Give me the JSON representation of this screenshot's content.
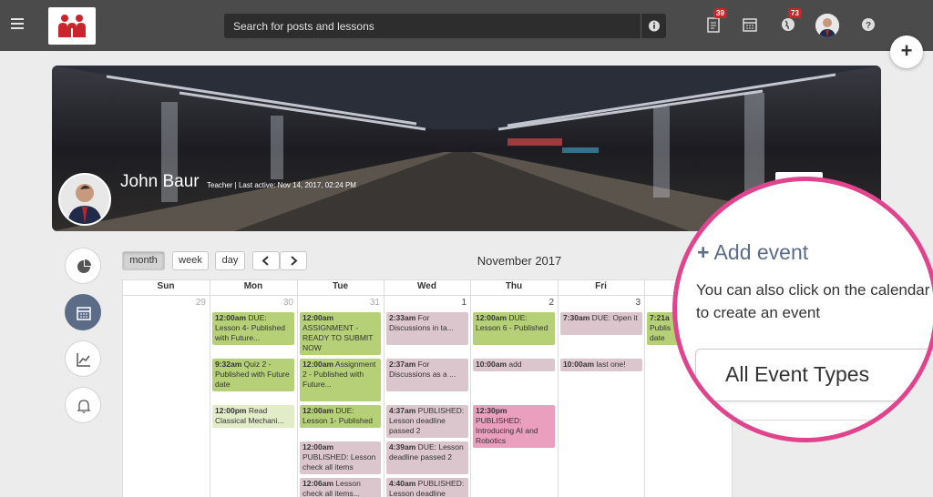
{
  "topbar": {
    "search_placeholder": "Search for posts and lessons",
    "icons": [
      "hamburger-icon",
      "notifications-icon",
      "calendar-icon",
      "globe-icon",
      "help-icon",
      "info-icon"
    ],
    "notifications_count": "39",
    "globe_count": "73",
    "accent": "#c9252c"
  },
  "profile": {
    "name": "John Baur",
    "meta": "Teacher | Last active: Nov 14, 2017, 02:24 PM"
  },
  "sidebar": {
    "items": [
      "pie-chart-icon",
      "calendar-icon",
      "line-chart-icon",
      "bell-icon"
    ]
  },
  "calendar": {
    "views": {
      "month": "month",
      "week": "week",
      "day": "day"
    },
    "title": "November 2017",
    "weekdays": [
      "Sun",
      "Mon",
      "Tue",
      "Wed",
      "Thu",
      "Fri",
      "Sat"
    ],
    "daynums": [
      "29",
      "30",
      "31",
      "1",
      "2",
      "3"
    ],
    "events": {
      "mon": [
        {
          "time": "12:00am",
          "text": " DUE: Lesson 4- Published with Future..."
        },
        {
          "time": "9:32am",
          "text": " Quiz 2 - Published with Future date"
        },
        {
          "time": "12:00pm",
          "text": " Read Classical Mechani..."
        }
      ],
      "tue": [
        {
          "time": "12:00am",
          "text": " ASSIGNMENT - READY TO SUBMIT NOW"
        },
        {
          "time": "12:00am",
          "text": " Assignment 2 - Published with Future..."
        },
        {
          "time": "12:00am",
          "text": " DUE: Lesson 1- Published"
        },
        {
          "time": "12:00am",
          "text": " PUBLISHED: Lesson check all items"
        },
        {
          "time": "12:06am",
          "text": " Lesson check all items..."
        }
      ],
      "wed": [
        {
          "time": "2:33am",
          "text": " For Discussions in ta..."
        },
        {
          "time": "2:37am",
          "text": " For Discussions as a ..."
        },
        {
          "time": "4:37am",
          "text": " PUBLISHED: Lesson deadline passed 2"
        },
        {
          "time": "4:39am",
          "text": " DUE: Lesson deadline passed 2"
        },
        {
          "time": "4:40am",
          "text": " PUBLISHED: Lesson deadline"
        }
      ],
      "thu": [
        {
          "time": "12:00am",
          "text": " DUE: Lesson 6 - Published"
        },
        {
          "time": "10:00am",
          "text": " add"
        },
        {
          "time": "12:30pm",
          "text": " PUBLISHED: Introducing AI and Robotics"
        }
      ],
      "fri": [
        {
          "time": "7:30am",
          "text": " DUE: Open it"
        },
        {
          "time": "10:00am",
          "text": " last one!"
        }
      ],
      "sat": [
        {
          "time": "7:21a",
          "text": " Publis date"
        }
      ]
    }
  },
  "zoom": {
    "add_plus": "+",
    "add_event": " Add event",
    "hint": "You can also click on the calendar to create an event",
    "filter": "All Event Types"
  },
  "fab_label": "+"
}
